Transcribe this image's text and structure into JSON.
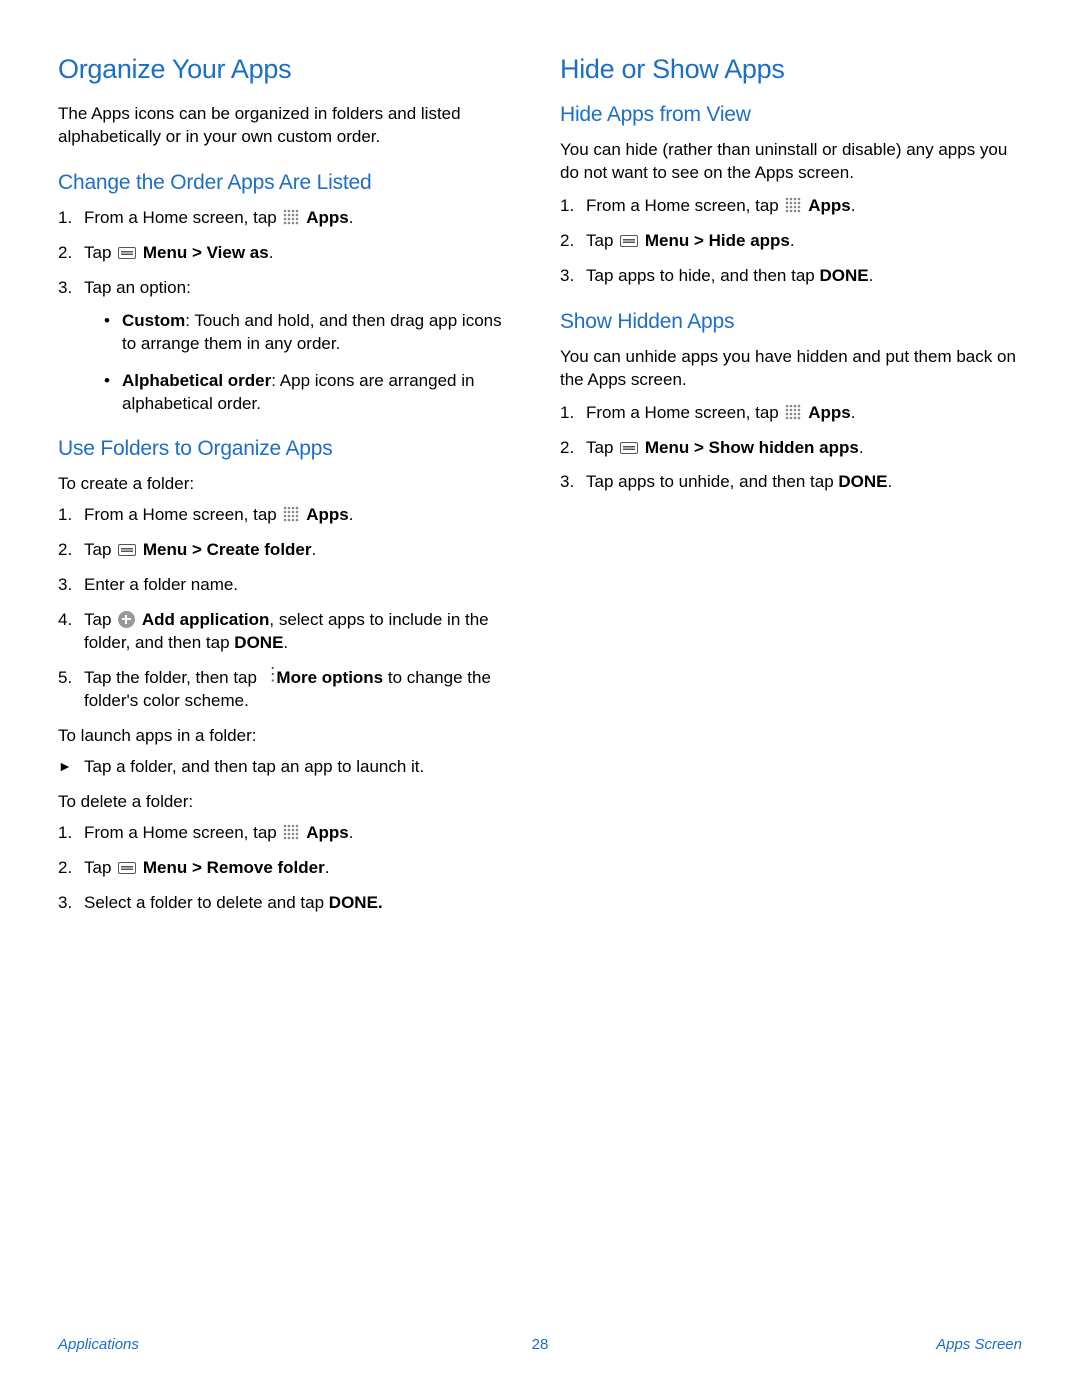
{
  "left": {
    "h1": "Organize Your Apps",
    "intro": "The Apps icons can be organized in folders and listed alphabetically or in your own custom order.",
    "change_order": {
      "h2": "Change the Order Apps Are Listed",
      "step1_pre": "From a Home screen, tap ",
      "step1_post": "Apps",
      "step2_pre": "Tap ",
      "step2_post": "Menu > View as",
      "step3": "Tap an option:",
      "bullet1_b": "Custom",
      "bullet1_t": ": Touch and hold, and then drag app icons to arrange them in any order.",
      "bullet2_b": "Alphabetical order",
      "bullet2_t": ": App icons are arranged in alphabetical order."
    },
    "folders": {
      "h2": "Use Folders to Organize Apps",
      "create_intro": "To create a folder:",
      "c1_pre": "From a Home screen, tap ",
      "c1_post": "Apps",
      "c2_pre": "Tap ",
      "c2_post": "Menu > Create folder",
      "c3": "Enter a folder name.",
      "c4_pre": "Tap ",
      "c4_b": "Add application",
      "c4_t": ", select apps to include in the folder, and then tap ",
      "c4_done": "DONE",
      "c5_pre": "Tap the folder, then tap ",
      "c5_b": "More options",
      "c5_t": " to change the folder's color scheme.",
      "launch_intro": "To launch apps in a folder:",
      "launch_line": "Tap a folder, and then tap an app to launch it.",
      "delete_intro": "To delete a folder:",
      "d1_pre": "From a Home screen, tap ",
      "d1_post": "Apps",
      "d2_pre": "Tap ",
      "d2_post": "Menu > Remove folder",
      "d3_pre": "Select a folder to delete and tap ",
      "d3_done": "DONE."
    }
  },
  "right": {
    "h1": "Hide or Show Apps",
    "hide": {
      "h2": "Hide Apps from View",
      "intro": "You can hide (rather than uninstall or disable) any apps you do not want to see on the Apps screen.",
      "s1_pre": "From a Home screen, tap ",
      "s1_post": "Apps",
      "s2_pre": "Tap ",
      "s2_post": "Menu > Hide apps",
      "s3_pre": "Tap apps to hide, and then tap ",
      "s3_done": "DONE"
    },
    "show": {
      "h2": "Show Hidden Apps",
      "intro": "You can unhide apps you have hidden and put them back on the Apps screen.",
      "s1_pre": "From a Home screen, tap ",
      "s1_post": "Apps",
      "s2_pre": "Tap ",
      "s2_post": "Menu > Show hidden apps",
      "s3_pre": "Tap apps to unhide, and then tap ",
      "s3_done": "DONE"
    }
  },
  "footer": {
    "left": "Applications",
    "center": "28",
    "right": "Apps Screen"
  }
}
